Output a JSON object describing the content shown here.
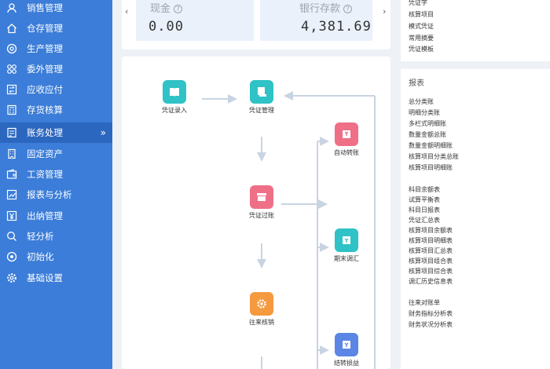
{
  "sidebar": {
    "items": [
      {
        "label": "销售管理",
        "icon": "user-icon"
      },
      {
        "label": "仓存管理",
        "icon": "home-icon"
      },
      {
        "label": "生产管理",
        "icon": "gear-icon"
      },
      {
        "label": "委外管理",
        "icon": "grid-icon"
      },
      {
        "label": "应收应付",
        "icon": "exchange-icon"
      },
      {
        "label": "存货核算",
        "icon": "calculator-icon"
      },
      {
        "label": "账务处理",
        "icon": "ledger-icon",
        "arrow": "»"
      },
      {
        "label": "固定资产",
        "icon": "building-icon"
      },
      {
        "label": "工资管理",
        "icon": "wallet-icon"
      },
      {
        "label": "报表与分析",
        "icon": "chart-icon"
      },
      {
        "label": "出纳管理",
        "icon": "yen-icon"
      },
      {
        "label": "轻分析",
        "icon": "magnifier-icon"
      },
      {
        "label": "初始化",
        "icon": "target-icon"
      },
      {
        "label": "基础设置",
        "icon": "settings-icon"
      }
    ]
  },
  "summary": {
    "cash": {
      "label": "现金",
      "value": "0.00",
      "help": "?"
    },
    "bank": {
      "label": "银行存款",
      "value": "4,381.69",
      "help": "?"
    },
    "prev_arrow": "‹",
    "next_arrow": "›"
  },
  "flow": {
    "nodes": [
      {
        "label": "凭证录入",
        "color": "#2fc2c6"
      },
      {
        "label": "凭证管理",
        "color": "#2fc2c6"
      },
      {
        "label": "凭证过账",
        "color": "#ef6f87"
      },
      {
        "label": "自动转账",
        "color": "#ef6f87"
      },
      {
        "label": "期末调汇",
        "color": "#2fc2c6"
      },
      {
        "label": "往来核销",
        "color": "#f59a3e"
      },
      {
        "label": "结转损益",
        "color": "#5b86e5"
      }
    ]
  },
  "quick_links": [
    "凭证字",
    "核算项目",
    "模式凭证",
    "常用摘要",
    "凭证模板"
  ],
  "reports": {
    "title": "报表",
    "group1": [
      "总分类账",
      "明细分类账",
      "多栏式明细账",
      "数量金额总账",
      "数量金额明细账",
      "核算项目分类总账",
      "核算项目明细账"
    ],
    "group2": [
      "科目余额表",
      "试算平衡表",
      "科目日报表",
      "凭证汇总表",
      "核算项目余额表",
      "核算项目明细表",
      "核算项目汇总表",
      "核算项目组合表",
      "核算项目综合表",
      "调汇历史信息表"
    ],
    "group3": [
      "往来对账单",
      "财务指标分析表",
      "财务状况分析表"
    ]
  },
  "colors": {
    "sidebar": "#3b7dd8",
    "sidebar_active": "#2c67bf",
    "card_bg": "#eaf1fb"
  }
}
